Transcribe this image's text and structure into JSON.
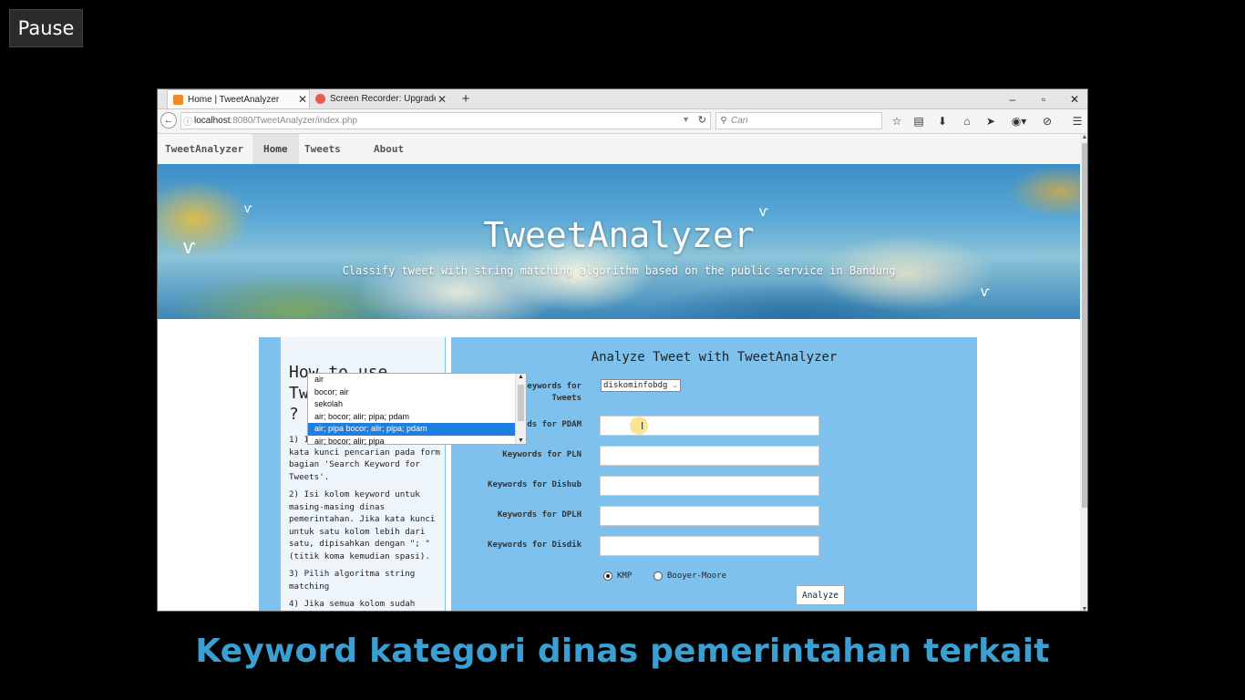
{
  "overlay": {
    "pause_label": "Pause",
    "caption": "Keyword kategori dinas pemerintahan terkait"
  },
  "browser": {
    "tabs": [
      {
        "label": "Home | TweetAnalyzer",
        "active": true
      },
      {
        "label": "Screen Recorder: Upgrade ...",
        "active": false
      }
    ],
    "url_host": "localhost",
    "url_path": ":8080/TweetAnalyzer/index.php",
    "search_placeholder": "Cari",
    "window_controls": [
      "–",
      "▫",
      "✕"
    ]
  },
  "site": {
    "brand": "TweetAnalyzer",
    "nav": [
      "Home",
      "Tweets",
      "About"
    ],
    "active_nav": "Home",
    "hero_title": "TweetAnalyzer",
    "hero_subtitle": "Classify tweet with string matching algorithm based on the public service in Bandung"
  },
  "howto": {
    "title": "How to use Tweet Analyzer ?",
    "steps": [
      "1) Isi form di sebelah. Pilih kata kunci pencarian pada form bagian 'Search Keyword for Tweets'.",
      "2) Isi kolom keyword untuk masing-masing dinas pemerintahan. Jika kata kunci untuk satu kolom lebih dari satu, dipisahkan dengan \"; \" (titik koma kemudian spasi).",
      "3) Pilih algoritma string matching",
      "4) Jika semua kolom sudah"
    ]
  },
  "form": {
    "title": "Analyze Tweet with TweetAnalyzer",
    "search_label": "Search Keywords for Tweets",
    "search_value": "diskominfobdg",
    "fields": [
      {
        "label": "Keywords for PDAM",
        "value": ""
      },
      {
        "label": "Keywords for PLN",
        "value": ""
      },
      {
        "label": "Keywords for Dishub",
        "value": ""
      },
      {
        "label": "Keywords for DPLH",
        "value": ""
      },
      {
        "label": "Keywords for Disdik",
        "value": ""
      }
    ],
    "autocomplete": [
      "air",
      "bocor; air",
      "sekolah",
      "air; bocor; alir; pipa; pdam",
      "air; pipa bocor; alir; pipa; pdam",
      "air; bocor; alir; pipa"
    ],
    "autocomplete_selected": 4,
    "algorithms": [
      "KMP",
      "Booyer-Moore"
    ],
    "selected_algorithm": "KMP",
    "submit_label": "Analyze"
  },
  "colors": {
    "panel": "#7ec1ec",
    "caption": "#3a9fd2",
    "selection": "#1e7fe0"
  }
}
